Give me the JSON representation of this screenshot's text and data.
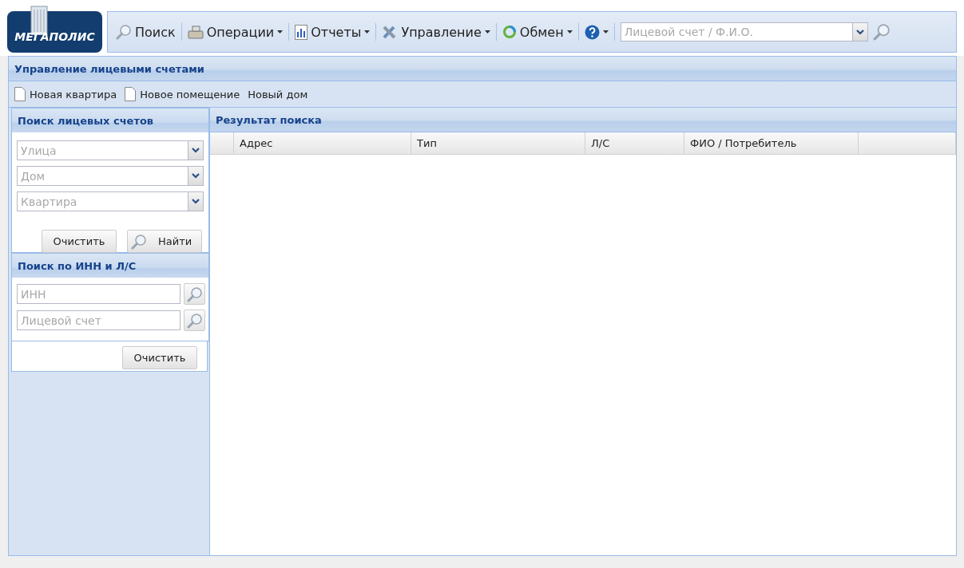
{
  "logo": {
    "text": "МЕГАПОЛИС"
  },
  "menu": [
    {
      "kind": "search",
      "label": "Поиск",
      "dropdown": false
    },
    {
      "kind": "operations",
      "label": "Операции",
      "dropdown": true
    },
    {
      "kind": "reports",
      "label": "Отчеты",
      "dropdown": true
    },
    {
      "kind": "admin",
      "label": "Управление",
      "dropdown": true
    },
    {
      "kind": "exchange",
      "label": "Обмен",
      "dropdown": true
    },
    {
      "kind": "help",
      "dropdown": true
    }
  ],
  "quick_search": {
    "placeholder": "Лицевой счет / Ф.И.О."
  },
  "panel": {
    "title": "Управление лицевыми счетами",
    "actions": [
      {
        "label": "Новая квартира",
        "icon": true
      },
      {
        "label": "Новое помещение",
        "icon": true
      },
      {
        "label": "Новый дом",
        "icon": false
      }
    ]
  },
  "address_search": {
    "title": "Поиск лицевых счетов",
    "fields": [
      {
        "placeholder": "Улица"
      },
      {
        "placeholder": "Дом"
      },
      {
        "placeholder": "Квартира"
      }
    ],
    "buttons": [
      {
        "label": "Очистить",
        "icon": false
      },
      {
        "label": "Найти",
        "icon": true
      }
    ]
  },
  "id_search": {
    "title": "Поиск по ИНН и Л/С",
    "fields": [
      {
        "placeholder": "ИНН"
      },
      {
        "placeholder": "Лицевой счет"
      }
    ],
    "button": "Очистить"
  },
  "results": {
    "title": "Результат поиска",
    "columns": [
      "Адрес",
      "Тип",
      "Л/С",
      "ФИО / Потребитель"
    ]
  }
}
